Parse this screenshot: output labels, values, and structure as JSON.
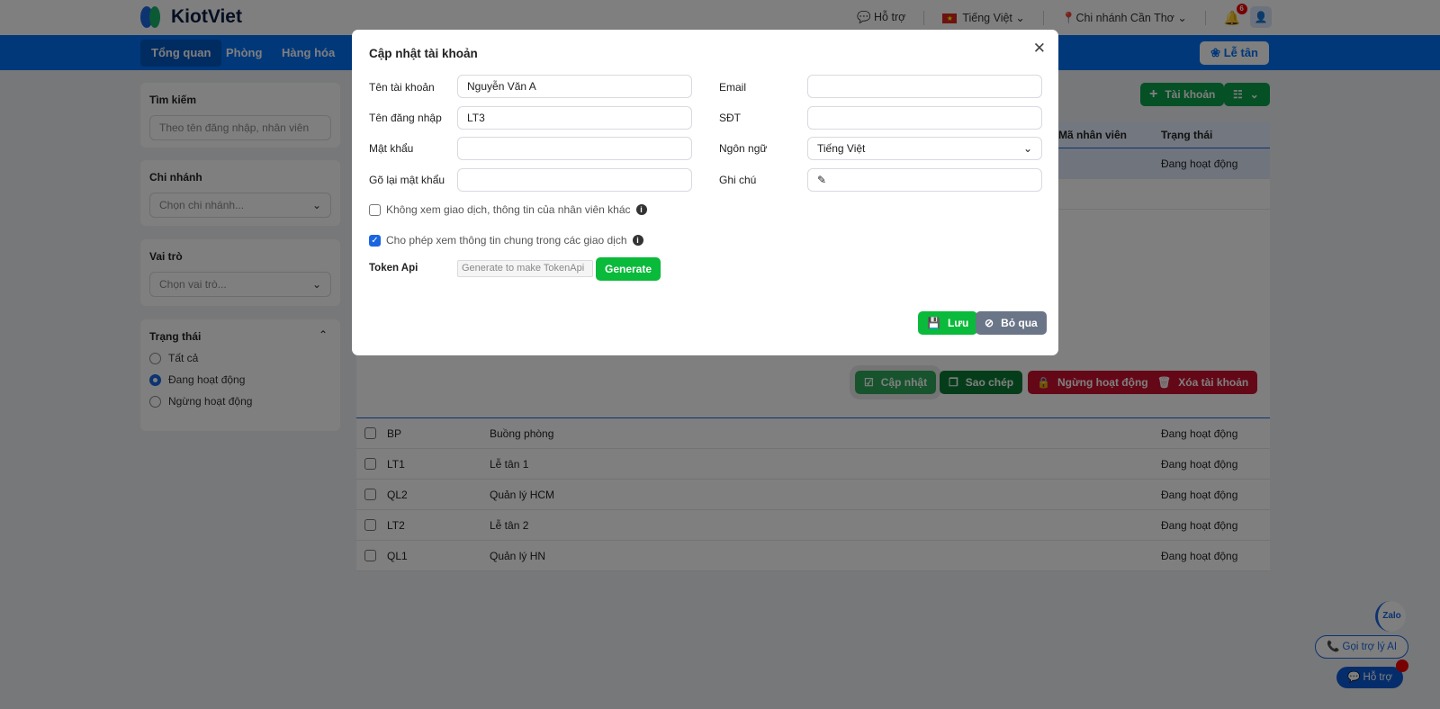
{
  "brand": {
    "name": "KiotViet"
  },
  "topbar": {
    "support": "Hỗ trợ",
    "language": "Tiếng Việt",
    "branch": "Chi nhánh Cần Thơ",
    "notifications": "6"
  },
  "nav": {
    "tabs": [
      "Tổng quan",
      "Phòng",
      "Hàng hóa"
    ],
    "reception": "Lễ tân"
  },
  "sidebar": {
    "search": {
      "title": "Tìm kiếm",
      "placeholder": "Theo tên đăng nhập, nhân viên"
    },
    "branch": {
      "title": "Chi nhánh",
      "placeholder": "Chọn chi nhánh..."
    },
    "role": {
      "title": "Vai trò",
      "placeholder": "Chọn vai trò..."
    },
    "status": {
      "title": "Trạng thái",
      "options": [
        "Tất cả",
        "Đang hoạt động",
        "Ngừng hoạt động"
      ],
      "selected": 1
    }
  },
  "toolbar": {
    "add_account": "Tài khoản"
  },
  "table": {
    "headers": {
      "employee_code": "Mã nhân viên",
      "status": "Trạng thái"
    },
    "selected_status": "Đang hoạt động",
    "actions": {
      "update": "Cập nhật",
      "copy": "Sao chép",
      "deactivate": "Ngừng hoạt động",
      "delete": "Xóa tài khoản"
    },
    "rows": [
      {
        "login": "BP",
        "name": "Buồng phòng",
        "status": "Đang hoạt động"
      },
      {
        "login": "LT1",
        "name": "Lễ tân 1",
        "status": "Đang hoạt động"
      },
      {
        "login": "QL2",
        "name": "Quản lý HCM",
        "status": "Đang hoạt động"
      },
      {
        "login": "LT2",
        "name": "Lễ tân 2",
        "status": "Đang hoạt động"
      },
      {
        "login": "QL1",
        "name": "Quản lý HN",
        "status": "Đang hoạt động"
      }
    ]
  },
  "modal": {
    "title": "Cập nhật tài khoản",
    "fields": {
      "account_name": {
        "label": "Tên tài khoản",
        "value": "Nguyễn Văn A"
      },
      "login_name": {
        "label": "Tên đăng nhập",
        "value": "LT3"
      },
      "password": {
        "label": "Mật khẩu",
        "value": ""
      },
      "password_confirm": {
        "label": "Gõ lại mật khẩu",
        "value": ""
      },
      "email": {
        "label": "Email",
        "value": ""
      },
      "phone": {
        "label": "SĐT",
        "value": ""
      },
      "language": {
        "label": "Ngôn ngữ",
        "value": "Tiếng Việt"
      },
      "note": {
        "label": "Ghi chú",
        "value": ""
      }
    },
    "checkbox_hide_others": {
      "label": "Không xem giao dịch, thông tin của nhân viên khác",
      "checked": false
    },
    "checkbox_allow_common": {
      "label": "Cho phép xem thông tin chung trong các giao dịch",
      "checked": true
    },
    "token": {
      "label": "Token Api",
      "placeholder": "Generate to make TokenApi",
      "button": "Generate"
    },
    "save": "Lưu",
    "cancel": "Bỏ qua"
  },
  "widgets": {
    "zalo": "Zalo",
    "ai_call": "Gọi trợ lý AI",
    "support": "Hỗ trợ"
  }
}
